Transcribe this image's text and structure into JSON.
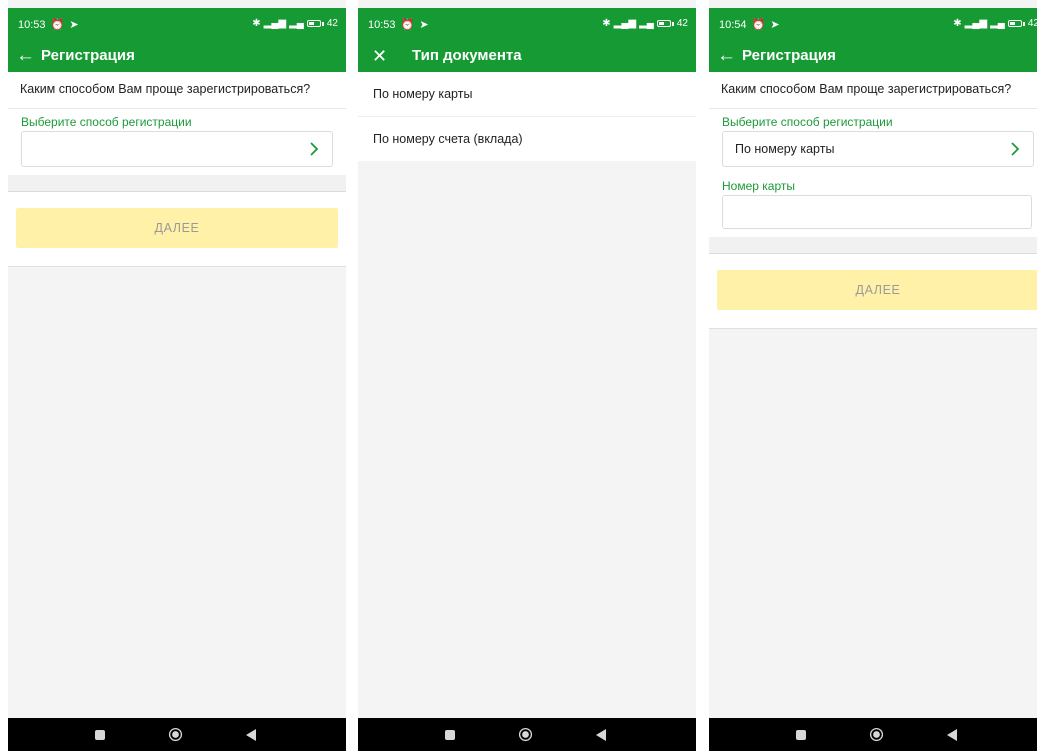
{
  "screens": [
    {
      "status": {
        "time": "10:53",
        "battery": "42"
      },
      "app_bar": {
        "title": "Регистрация",
        "nav_icon": "arrow-left-icon"
      },
      "question": "Каким способом Вам проще зарегистрироваться?",
      "method_label": "Выберите способ регистрации",
      "method_value": "",
      "next_label": "ДАЛЕЕ"
    },
    {
      "status": {
        "time": "10:53",
        "battery": "42"
      },
      "app_bar": {
        "title": "Тип документа",
        "nav_icon": "close-icon"
      },
      "options": [
        {
          "label": "По номеру карты"
        },
        {
          "label": "По номеру счета (вклада)"
        }
      ]
    },
    {
      "status": {
        "time": "10:54",
        "battery": "42"
      },
      "app_bar": {
        "title": "Регистрация",
        "nav_icon": "arrow-left-icon"
      },
      "question": "Каким способом Вам проще зарегистрироваться?",
      "method_label": "Выберите способ регистрации",
      "method_value": "По номеру карты",
      "card_label": "Номер карты",
      "card_value": "",
      "next_label": "ДАЛЕЕ"
    }
  ],
  "colors": {
    "brand_green": "#169a33",
    "label_green": "#1d9a3a",
    "button_disabled": "#fff2a8",
    "button_text_disabled": "#9a9a9a"
  }
}
